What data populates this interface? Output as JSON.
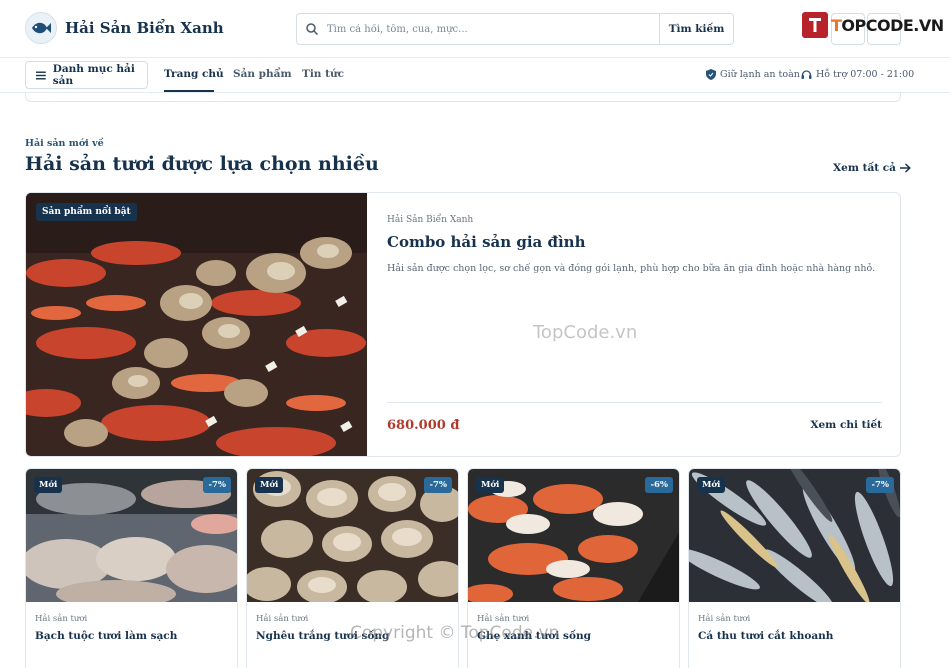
{
  "header": {
    "brand": "Hải Sản Biển Xanh",
    "search_placeholder": "Tìm cá hồi, tôm, cua, mực...",
    "search_button": "Tìm kiếm",
    "watermark_a": "T",
    "watermark_b": "OPCODE.VN"
  },
  "nav": {
    "category_button": "Danh mục hải sản",
    "links": [
      "Trang chủ",
      "Sản phẩm",
      "Tin tức"
    ],
    "active": "Trang chủ",
    "info_fresh": "Giữ lạnh an toàn",
    "info_support": "Hỗ trợ 07:00 - 21:00"
  },
  "section": {
    "eyebrow": "Hải sản mới về",
    "title": "Hải sản tươi được lựa chọn nhiều",
    "see_all": "Xem tất cả"
  },
  "featured": {
    "badge": "Sản phẩm nổi bật",
    "brand": "Hải Sản Biển Xanh",
    "title": "Combo hải sản gia đình",
    "description": "Hải sản được chọn lọc, sơ chế gọn và đóng gói lạnh, phù hợp cho bữa ăn gia đình hoặc nhà hàng nhỏ.",
    "price": "680.000 đ",
    "detail_link": "Xem chi tiết"
  },
  "products": [
    {
      "badge": "Mới",
      "discount": "-7%",
      "category": "Hải sản tươi",
      "name": "Bạch tuộc tươi làm sạch"
    },
    {
      "badge": "Mới",
      "discount": "-7%",
      "category": "Hải sản tươi",
      "name": "Nghêu trắng tươi sống"
    },
    {
      "badge": "Mới",
      "discount": "-6%",
      "category": "Hải sản tươi",
      "name": "Ghẹ xanh tươi sống"
    },
    {
      "badge": "Mới",
      "discount": "-7%",
      "category": "Hải sản tươi",
      "name": "Cá thu tươi cắt khoanh"
    }
  ],
  "watermarks": {
    "center": "TopCode.vn",
    "footer": "Copyright © TopCode.vn"
  },
  "colors": {
    "primary": "#17324d",
    "price": "#b03a2e",
    "discount": "#2a6a9b"
  }
}
